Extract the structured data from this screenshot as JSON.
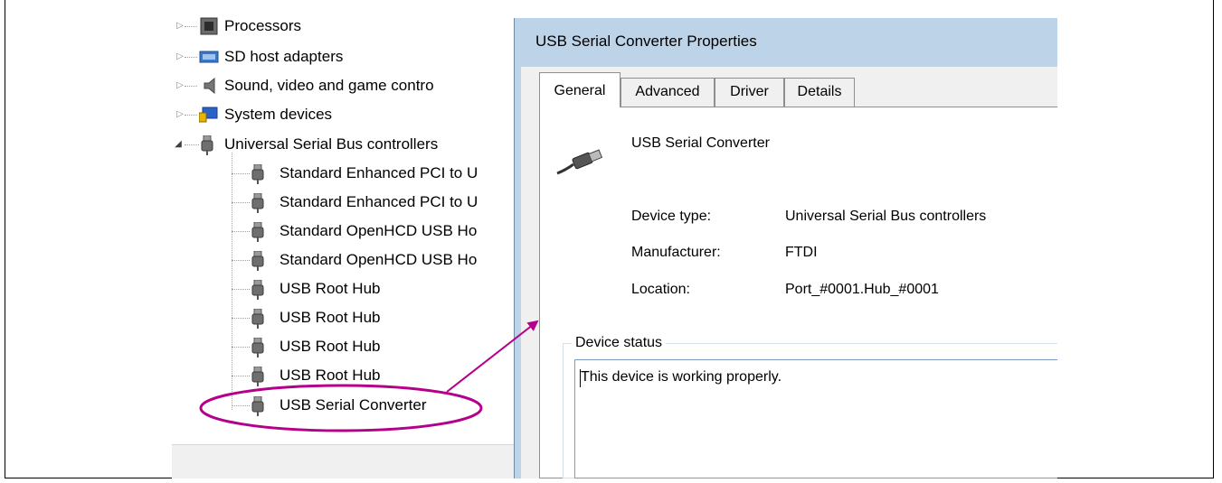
{
  "device_manager": {
    "items": [
      {
        "label": "Processors",
        "icon": "processor-icon",
        "expander": "collapsed"
      },
      {
        "label": "SD host adapters",
        "icon": "sd-adapter-icon",
        "expander": "collapsed"
      },
      {
        "label": "Sound, video and game contro",
        "icon": "speaker-icon",
        "expander": "collapsed"
      },
      {
        "label": "System devices",
        "icon": "system-devices-icon",
        "expander": "collapsed"
      },
      {
        "label": "Universal Serial Bus controllers",
        "icon": "usb-plug-icon",
        "expander": "expanded"
      }
    ],
    "usb_children": [
      {
        "label": "Standard Enhanced PCI to U"
      },
      {
        "label": "Standard Enhanced PCI to U"
      },
      {
        "label": "Standard OpenHCD USB Ho"
      },
      {
        "label": "Standard OpenHCD USB Ho"
      },
      {
        "label": "USB Root Hub"
      },
      {
        "label": "USB Root Hub"
      },
      {
        "label": "USB Root Hub"
      },
      {
        "label": "USB Root Hub"
      },
      {
        "label": "USB Serial Converter"
      }
    ]
  },
  "dialog": {
    "title": "USB Serial Converter Properties",
    "tabs": [
      "General",
      "Advanced",
      "Driver",
      "Details"
    ],
    "active_tab": "General",
    "device_name": "USB Serial Converter",
    "properties": [
      {
        "label": "Device type:",
        "value": "Universal Serial Bus controllers"
      },
      {
        "label": "Manufacturer:",
        "value": "FTDI"
      },
      {
        "label": "Location:",
        "value": "Port_#0001.Hub_#0001"
      }
    ],
    "status_group_label": "Device status",
    "status_text": "This device is working properly."
  },
  "annotation": {
    "color": "#b5008a"
  }
}
